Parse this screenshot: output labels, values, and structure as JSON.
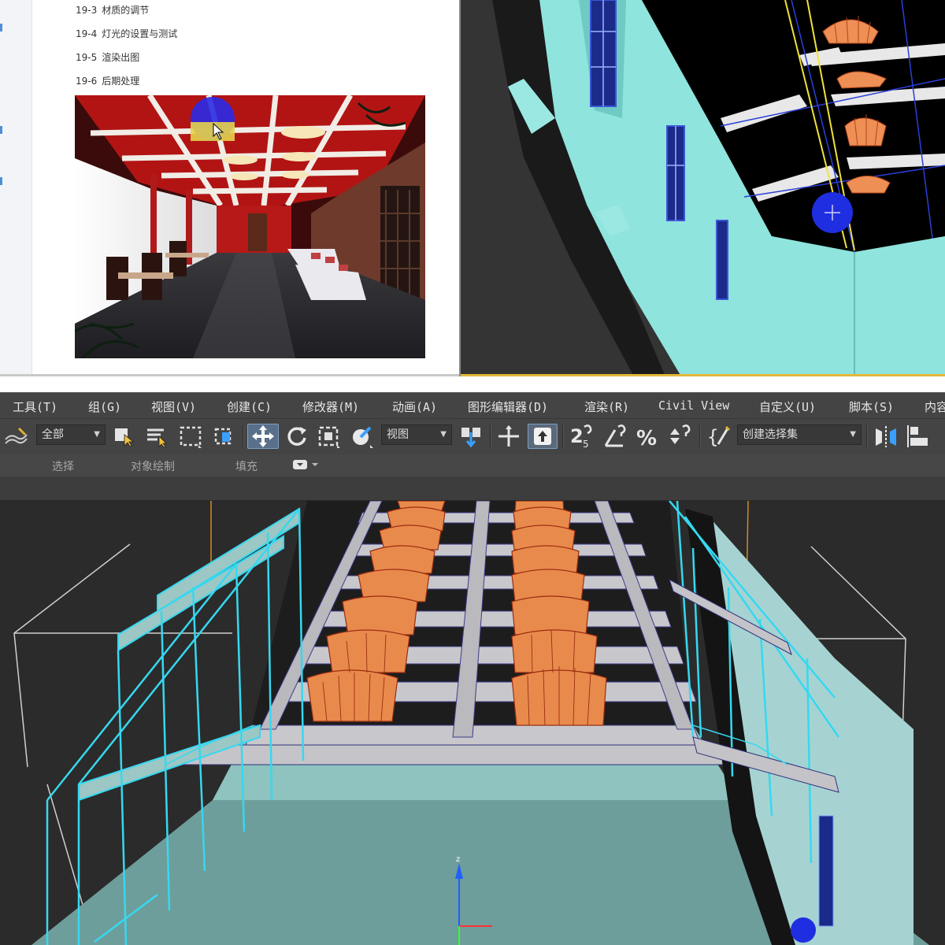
{
  "document": {
    "toc": [
      {
        "num": "19-3",
        "title": "材质的调节"
      },
      {
        "num": "19-4",
        "title": "灯光的设置与测试"
      },
      {
        "num": "19-5",
        "title": "渲染出图"
      },
      {
        "num": "19-6",
        "title": "后期处理"
      }
    ]
  },
  "menubar": {
    "items": [
      "工具(T)",
      "组(G)",
      "视图(V)",
      "创建(C)",
      "修改器(M)",
      "动画(A)",
      "图形编辑器(D)",
      "渲染(R)",
      "Civil View",
      "自定义(U)",
      "脚本(S)",
      "内容"
    ]
  },
  "toolbar": {
    "selection_filter": "全部",
    "reference_coord": "视图",
    "named_selection": "创建选择集",
    "active_tool": "move-icon",
    "icons": [
      "undo-redo-icon",
      "select-object-icon",
      "select-by-name-icon",
      "rect-region-icon",
      "window-crossing-icon",
      "move-icon",
      "rotate-icon",
      "scale-icon",
      "place-icon",
      "pivot-icon",
      "manipulate-icon",
      "keyboard-shortcut-icon",
      "snap-2-5-icon",
      "angle-snap-icon",
      "percent-snap-icon",
      "spinner-snap-icon",
      "edit-named-sets-icon",
      "mirror-icon",
      "align-icon"
    ]
  },
  "ribbon": {
    "tabs": [
      "选择",
      "对象绘制",
      "填充"
    ]
  },
  "colors": {
    "ui_bg": "#444444",
    "viewport_bg": "#2b2b2b",
    "selection_cyan": "#36d8f0",
    "wall_teal": "#7fd6d2",
    "lamp_orange": "#e98a4d",
    "active_blue": "#5a6f8a"
  }
}
